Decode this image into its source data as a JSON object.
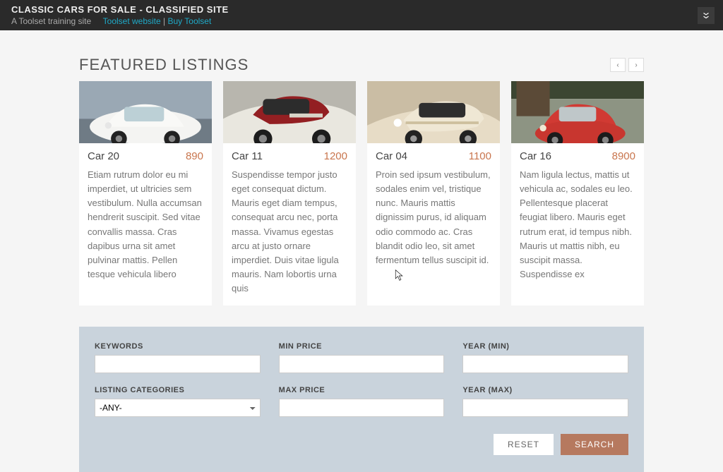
{
  "topbar": {
    "title": "CLASSIC CARS FOR SALE - CLASSIFIED SITE",
    "subline_prefix": "A Toolset training site",
    "link1": "Toolset website",
    "separator": " | ",
    "link2": "Buy Toolset"
  },
  "featured": {
    "heading": "FEATURED LISTINGS",
    "prev_symbol": "‹",
    "next_symbol": "›",
    "items": [
      {
        "title": "Car 20",
        "price": "890",
        "desc": "Etiam rutrum dolor eu mi imperdiet, ut ultricies sem vestibulum. Nulla accumsan hendrerit suscipit. Sed vitae convallis massa. Cras dapibus urna sit amet pulvinar mattis. Pellen tesque vehicula libero"
      },
      {
        "title": "Car 11",
        "price": "1200",
        "desc": "Suspendisse tempor justo eget consequat dictum. Mauris eget diam tempus, consequat arcu nec, porta massa. Vivamus egestas arcu at justo ornare imperdiet. Duis vitae ligula mauris. Nam lobortis urna quis"
      },
      {
        "title": "Car 04",
        "price": "1100",
        "desc": "Proin sed ipsum vestibulum, sodales enim vel, tristique nunc. Mauris mattis dignissim purus, id aliquam odio commodo ac. Cras blandit odio leo, sit amet fermentum tellus suscipit id."
      },
      {
        "title": "Car 16",
        "price": "8900",
        "desc": "Nam ligula lectus, mattis ut vehicula ac, sodales eu leo. Pellentesque placerat feugiat libero. Mauris eget rutrum erat, id tempus nibh. Mauris ut mattis nibh, eu suscipit massa. Suspendisse ex"
      }
    ]
  },
  "filters": {
    "keywords_label": "KEYWORDS",
    "categories_label": "LISTING CATEGORIES",
    "categories_value": "-ANY-",
    "min_price_label": "MIN PRICE",
    "max_price_label": "MAX PRICE",
    "year_min_label": "YEAR (MIN)",
    "year_max_label": "YEAR (MAX)",
    "reset_label": "RESET",
    "search_label": "SEARCH"
  }
}
